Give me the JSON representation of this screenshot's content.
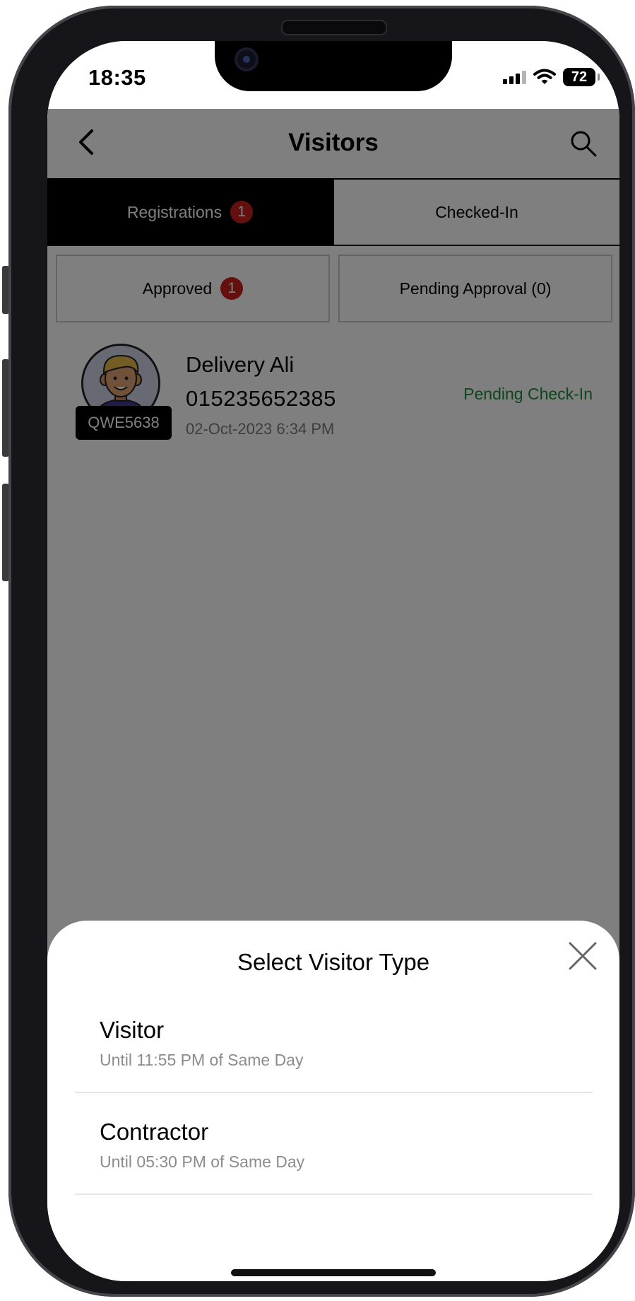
{
  "status_bar": {
    "time": "18:35",
    "battery": "72",
    "icons": [
      "signal-icon",
      "wifi-icon",
      "battery-icon"
    ]
  },
  "header": {
    "title": "Visitors",
    "back_icon": "chevron-left-icon",
    "search_icon": "search-icon"
  },
  "main_tabs": [
    {
      "label": "Registrations",
      "badge": "1",
      "active": true
    },
    {
      "label": "Checked-In",
      "active": false
    }
  ],
  "sub_tabs": [
    {
      "label": "Approved",
      "badge": "1"
    },
    {
      "label": "Pending Approval (0)"
    }
  ],
  "visitors": [
    {
      "name": "Delivery Ali",
      "phone": "015235652385",
      "date": "02-Oct-2023 6:34 PM",
      "code": "QWE5638",
      "status": "Pending Check-In"
    }
  ],
  "sheet": {
    "title": "Select Visitor Type",
    "close_icon": "close-icon",
    "options": [
      {
        "title": "Visitor",
        "subtitle": "Until 11:55 PM of Same Day"
      },
      {
        "title": "Contractor",
        "subtitle": "Until 05:30 PM of Same Day"
      }
    ]
  },
  "colors": {
    "badge": "#c8201e",
    "status_green": "#1e8a3a",
    "active_tab": "#000000",
    "overlay": "rgba(0,0,0,0.5)"
  }
}
